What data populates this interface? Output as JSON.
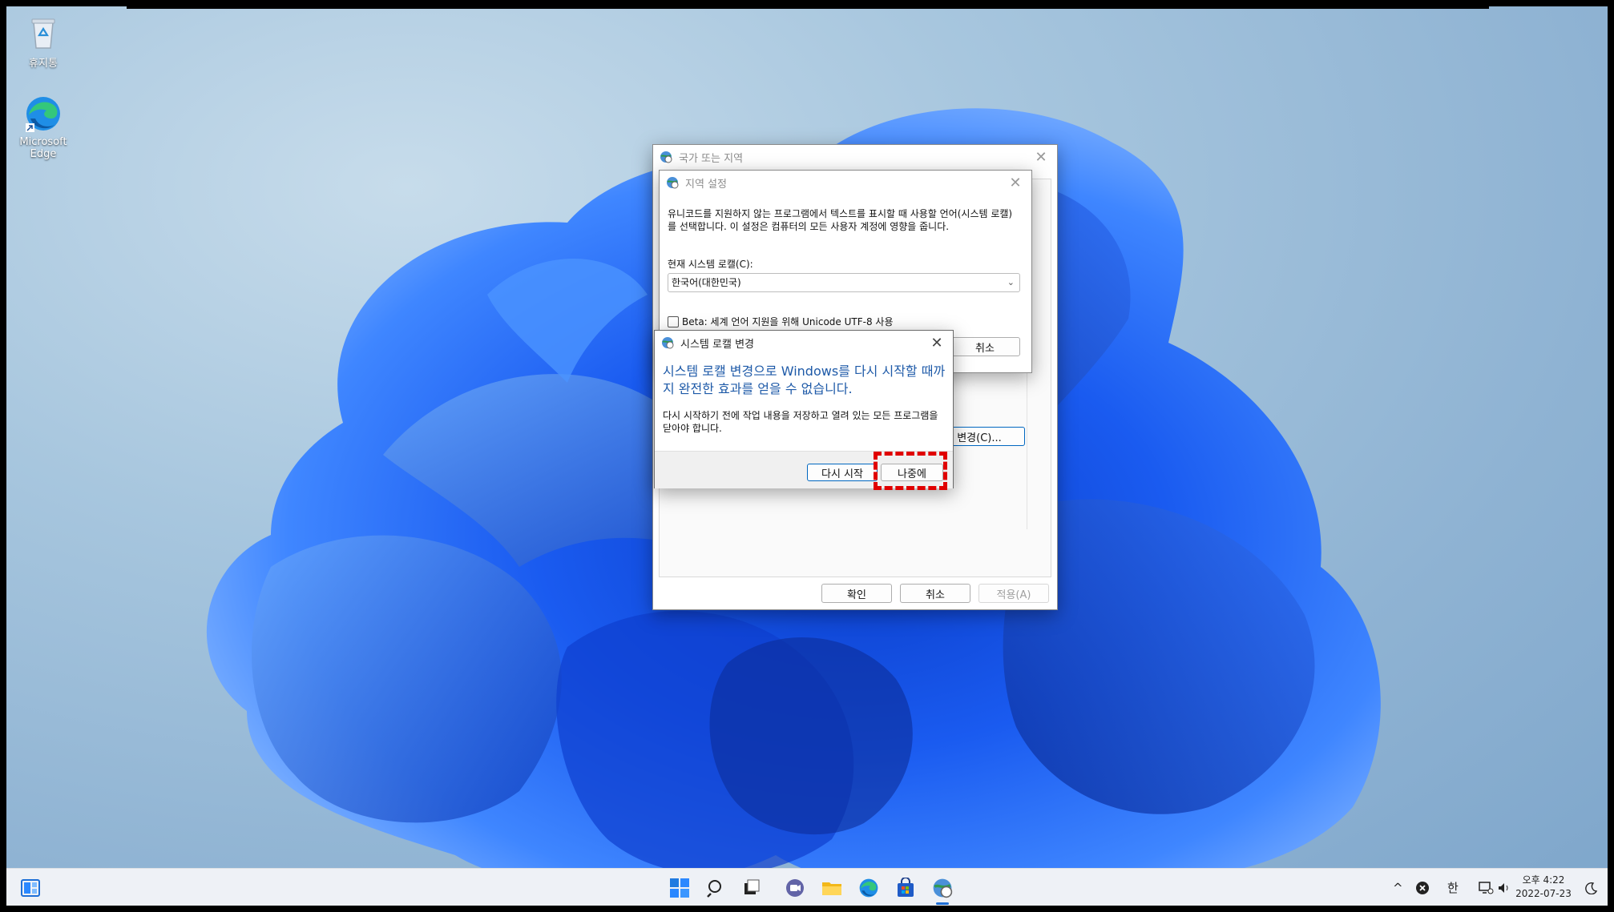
{
  "desktop": {
    "icons": [
      {
        "label": "휴지통"
      },
      {
        "label": "Microsoft Edge"
      }
    ]
  },
  "region_window": {
    "title": "국가 또는 지역",
    "ok_label": "확인",
    "cancel_label": "취소",
    "apply_label": "적용(A)",
    "change_locale_label": "변경(C)..."
  },
  "region_settings_dialog": {
    "title": "지역 설정",
    "description": "유니코드를 지원하지 않는 프로그램에서 텍스트를 표시할 때 사용할 언어(시스템 로캘)를 선택합니다. 이 설정은 컴퓨터의 모든 사용자 계정에 영향을 줍니다.",
    "locale_label": "현재 시스템 로캘(C):",
    "locale_value": "한국어(대한민국)",
    "beta_label": "Beta: 세계 언어 지원을 위해 Unicode UTF-8 사용",
    "cancel_label": "취소"
  },
  "locale_change_dialog": {
    "title": "시스템 로캘 변경",
    "heading": "시스템 로캘 변경으로 Windows를 다시 시작할 때까지 완전한 효과를 얻을 수 없습니다.",
    "body": "다시 시작하기 전에 작업 내용을 저장하고 열려 있는 모든 프로그램을 닫아야 합니다.",
    "restart_label": "다시 시작",
    "later_label": "나중에"
  },
  "taskbar": {
    "ime_label": "한",
    "time": "오후 4:22",
    "date": "2022-07-23"
  },
  "colors": {
    "accent": "#0067c0",
    "heading_blue": "#1e5aa8",
    "highlight": "#e00000"
  }
}
